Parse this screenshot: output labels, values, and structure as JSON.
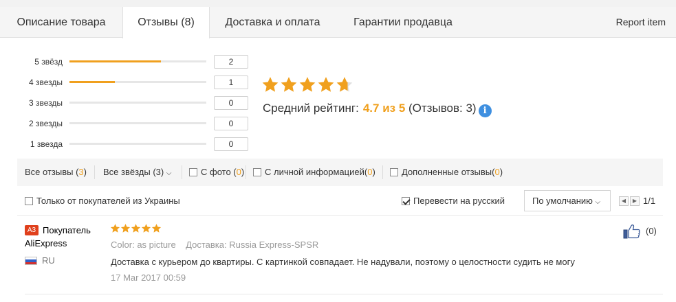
{
  "tabs": [
    {
      "label": "Описание товара",
      "active": false
    },
    {
      "label": "Отзывы (8)",
      "active": true
    },
    {
      "label": "Доставка и оплата",
      "active": false
    },
    {
      "label": "Гарантии продавца",
      "active": false
    }
  ],
  "report_item": "Report item",
  "histogram": [
    {
      "label": "5 звёзд",
      "count": "2",
      "fill_fraction": 0.67
    },
    {
      "label": "4 звезды",
      "count": "1",
      "fill_fraction": 0.33
    },
    {
      "label": "3 звезды",
      "count": "0",
      "fill_fraction": 0
    },
    {
      "label": "2 звезды",
      "count": "0",
      "fill_fraction": 0
    },
    {
      "label": "1 звезда",
      "count": "0",
      "fill_fraction": 0
    }
  ],
  "summary": {
    "stars": 4.7,
    "avg_label": "Средний рейтинг:",
    "avg_value": "4.7 из 5",
    "reviews_text": "(Отзывов: 3)",
    "info_icon": "info-icon"
  },
  "filters": {
    "all_reviews": "Все отзывы (",
    "all_reviews_count": "3",
    "all_reviews_close": ")",
    "all_stars": "Все звёзды (3)",
    "with_photo": "С фото (",
    "with_photo_count": "0",
    "with_photo_close": ")",
    "personal_info": "С личной информацией(",
    "personal_info_count": "0",
    "personal_info_close": ")",
    "supplemented": "Дополненные отзывы(",
    "supplemented_count": "0",
    "supplemented_close": ")"
  },
  "options": {
    "ukraine_only": "Только от покупателей из Украины",
    "ukraine_only_checked": false,
    "translate": "Перевести на русский",
    "translate_checked": true,
    "sort": "По умолчанию",
    "page": "1/1"
  },
  "review": {
    "badge": "A3",
    "author_line1": "Покупатель",
    "author_line2": "AliExpress",
    "country": "RU",
    "stars": 5,
    "color_label": "Color:",
    "color_value": "as picture",
    "delivery_label": "Доставка:",
    "delivery_value": "Russia Express-SPSR",
    "text": "Доставка с курьером до квартиры. С картинкой совпадает. Не надували, поэтому о целостности судить не могу",
    "date": "17 Mar 2017 00:59",
    "likes": "(0)"
  },
  "colors": {
    "accent": "#f0a01e",
    "info": "#3e8fe0",
    "badge": "#e0401c"
  }
}
